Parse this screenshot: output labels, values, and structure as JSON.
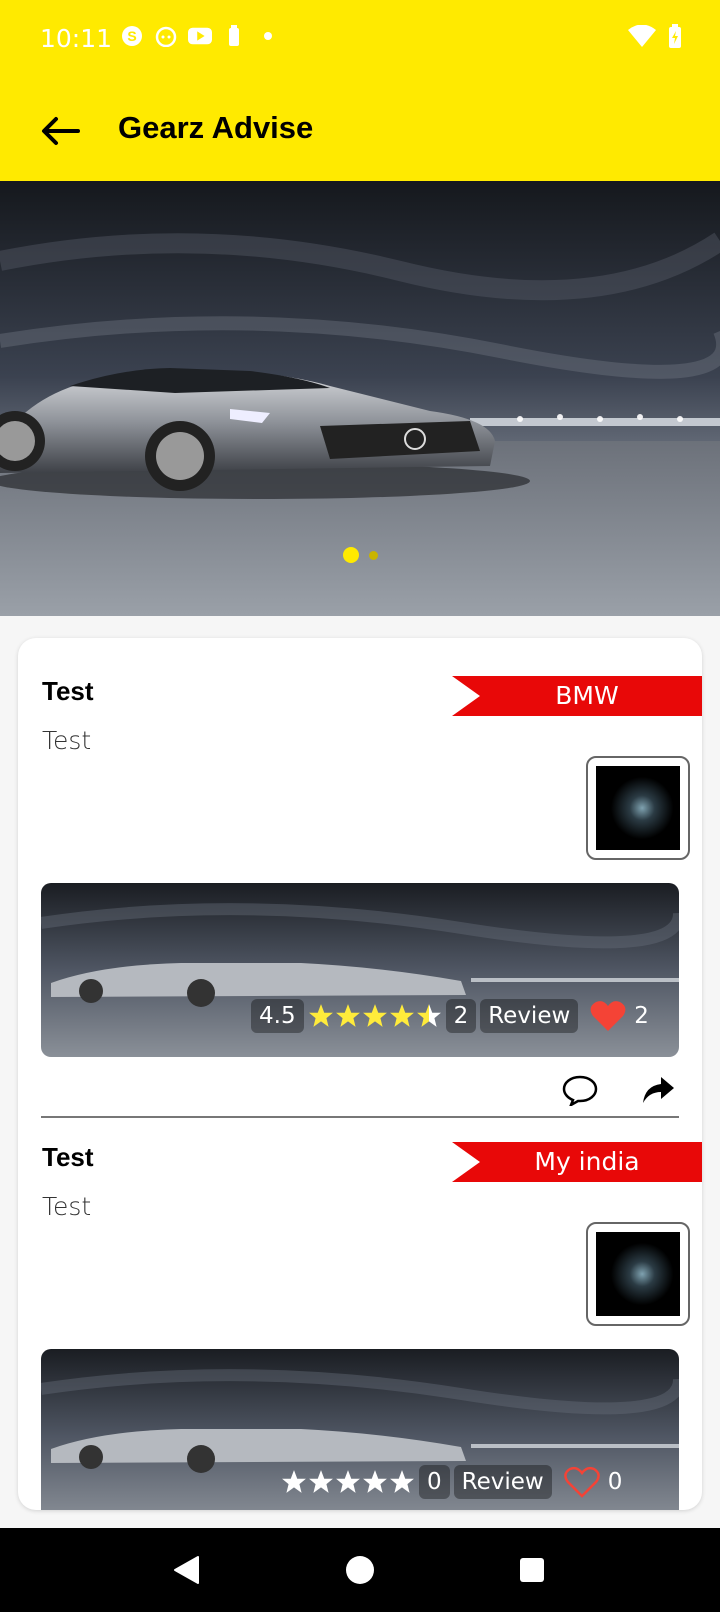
{
  "status_bar": {
    "time": "10:11",
    "icons": [
      "skype-icon",
      "face-icon",
      "youtube-icon",
      "battery-icon",
      "dot-icon"
    ],
    "right_icons": [
      "wifi-icon",
      "battery-charging-icon"
    ]
  },
  "app_bar": {
    "title": "Gearz Advise",
    "back_icon": "arrow-left-icon"
  },
  "carousel": {
    "slide_count": 2,
    "active_index": 0
  },
  "posts": [
    {
      "title": "Test",
      "subtitle": "Test",
      "category": "BMW",
      "rating": "4.5",
      "rating_value": 4.5,
      "review_count": "2",
      "review_label": "Review",
      "likes": "2",
      "liked": true
    },
    {
      "title": "Test",
      "subtitle": "Test",
      "category": "My india",
      "rating": "",
      "rating_value": 0,
      "review_count": "0",
      "review_label": "Review",
      "likes": "0",
      "liked": false
    }
  ],
  "colors": {
    "accent": "#ffea00",
    "tag_red": "#e80808",
    "heart_red": "#f44336",
    "star_yellow": "#ffeb3b"
  }
}
